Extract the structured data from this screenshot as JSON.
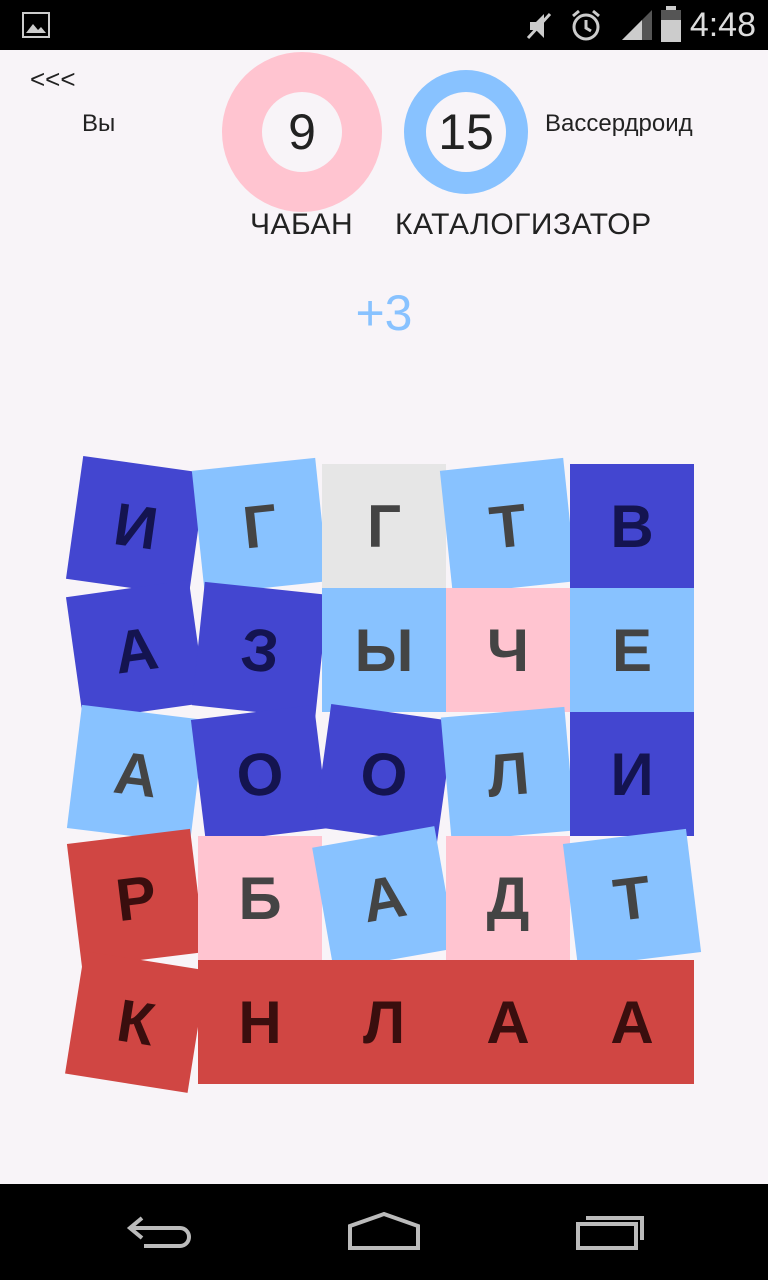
{
  "status_bar": {
    "time": "4:48"
  },
  "header": {
    "back_label": "<<<",
    "player_name": "Вы",
    "opponent_name": "Вассердроид",
    "player_score": "9",
    "opponent_score": "15",
    "player_last_word": "ЧАБАН",
    "opponent_last_word": "КАТАЛОГИЗАТОР"
  },
  "points_gained": "+3",
  "colors": {
    "player": "#ffc4d0",
    "opponent": "#88c2ff",
    "opponent_locked": "#4346d0",
    "neutral": "#e6e6e6",
    "selected_word": "#d04643"
  },
  "board": {
    "rows": [
      [
        {
          "letter": "И",
          "color": "dark"
        },
        {
          "letter": "Г",
          "color": "light"
        },
        {
          "letter": "Г",
          "color": "gray"
        },
        {
          "letter": "Т",
          "color": "light"
        },
        {
          "letter": "В",
          "color": "dark"
        }
      ],
      [
        {
          "letter": "А",
          "color": "dark"
        },
        {
          "letter": "З",
          "color": "dark"
        },
        {
          "letter": "Ы",
          "color": "light"
        },
        {
          "letter": "Ч",
          "color": "pink"
        },
        {
          "letter": "Е",
          "color": "light"
        }
      ],
      [
        {
          "letter": "А",
          "color": "light"
        },
        {
          "letter": "О",
          "color": "dark"
        },
        {
          "letter": "О",
          "color": "dark"
        },
        {
          "letter": "Л",
          "color": "light"
        },
        {
          "letter": "И",
          "color": "dark"
        }
      ],
      [
        {
          "letter": "Р",
          "color": "red"
        },
        {
          "letter": "Б",
          "color": "pink"
        },
        {
          "letter": "А",
          "color": "light"
        },
        {
          "letter": "Д",
          "color": "pink"
        },
        {
          "letter": "Т",
          "color": "light"
        }
      ],
      [
        {
          "letter": "К",
          "color": "red"
        },
        {
          "letter": "Н",
          "color": "red"
        },
        {
          "letter": "Л",
          "color": "red"
        },
        {
          "letter": "А",
          "color": "red"
        },
        {
          "letter": "А",
          "color": "red"
        }
      ]
    ]
  },
  "nav": {
    "back_icon": "back-icon",
    "home_icon": "home-icon",
    "recents_icon": "recents-icon"
  }
}
